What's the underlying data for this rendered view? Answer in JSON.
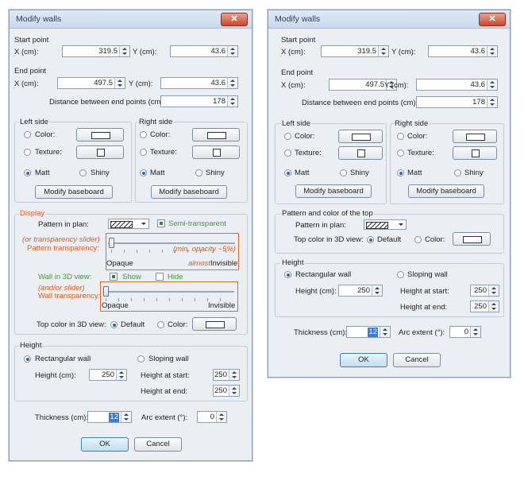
{
  "left": {
    "title": "Modify walls",
    "close": "✕",
    "start_point": {
      "label": "Start point",
      "x_label": "X (cm):",
      "x": "319.5",
      "y_label": "Y (cm):",
      "y": "43.6"
    },
    "end_point": {
      "label": "End point",
      "x_label": "X (cm):",
      "x": "497.5",
      "y_label": "Y (cm):",
      "y": "43.6",
      "distance_label": "Distance between end points (cm):",
      "distance": "178"
    },
    "left_side": {
      "label": "Left side",
      "color": "Color:",
      "texture": "Texture:",
      "matt": "Matt",
      "shiny": "Shiny",
      "baseboard": "Modify baseboard"
    },
    "right_side": {
      "label": "Right side",
      "color": "Color:",
      "texture": "Texture:",
      "matt": "Matt",
      "shiny": "Shiny",
      "baseboard": "Modify baseboard"
    },
    "display": {
      "label": "Display",
      "pattern_label": "Pattern in plan:",
      "semi_transparent": "Semi-transparent",
      "transparency_note": "(or transparency slider)",
      "pattern_transparency": "Pattern transparency:",
      "min_opacity": "(min. opacity ~5%)",
      "opaque": "Opaque",
      "almost": "almost",
      "invisible": "Invisible",
      "wall_3d_label": "Wall in 3D view:",
      "show": "Show",
      "hide": "Hide",
      "slider_note": "(and/or slider)",
      "wall_transparency": "Wall transparency:",
      "opaque2": "Opaque",
      "invisible2": "Invisible",
      "top_color_label": "Top color in 3D view:",
      "default": "Default",
      "color": "Color:"
    },
    "height": {
      "label": "Height",
      "rect": "Rectangular wall",
      "sloping": "Sloping wall",
      "height_label": "Height (cm):",
      "height": "250",
      "start_label": "Height at start:",
      "start": "250",
      "end_label": "Height at end:",
      "end": "250"
    },
    "thickness_label": "Thickness (cm):",
    "thickness": "12",
    "arc_label": "Arc extent (°):",
    "arc": "0",
    "ok": "OK",
    "cancel": "Cancel"
  },
  "right": {
    "title": "Modify walls",
    "close": "✕",
    "start_point": {
      "label": "Start point",
      "x_label": "X (cm):",
      "x": "319.5",
      "y_label": "Y (cm):",
      "y": "43.6"
    },
    "end_point": {
      "label": "End point",
      "x_label": "X (cm):",
      "x": "497.5",
      "y_label": "Y (cm):",
      "y": "43.6",
      "distance_label": "Distance between end points (cm):",
      "distance": "178"
    },
    "left_side": {
      "label": "Left side",
      "color": "Color:",
      "texture": "Texture:",
      "matt": "Matt",
      "shiny": "Shiny",
      "baseboard": "Modify baseboard"
    },
    "right_side": {
      "label": "Right side",
      "color": "Color:",
      "texture": "Texture:",
      "matt": "Matt",
      "shiny": "Shiny",
      "baseboard": "Modify baseboard"
    },
    "pattern_top": {
      "label": "Pattern and color of the top",
      "pattern_label": "Pattern in plan:",
      "top_color_label": "Top color in 3D view:",
      "default": "Default",
      "color": "Color:"
    },
    "height": {
      "label": "Height",
      "rect": "Rectangular wall",
      "sloping": "Sloping wall",
      "height_label": "Height (cm):",
      "height": "250",
      "start_label": "Height at start:",
      "start": "250",
      "end_label": "Height at end:",
      "end": "250"
    },
    "thickness_label": "Thickness (cm):",
    "thickness": "12",
    "arc_label": "Arc extent (°):",
    "arc": "0",
    "ok": "OK",
    "cancel": "Cancel"
  }
}
